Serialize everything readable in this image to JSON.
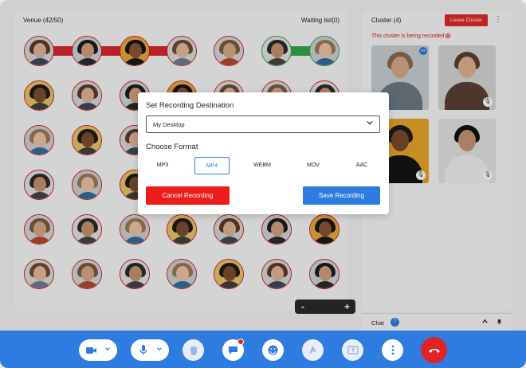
{
  "venue": {
    "title": "Venue (42/50)",
    "waiting": "Waiting list(0)"
  },
  "cluster": {
    "title": "Cluster (4)",
    "leave_label": "Leave Cluster",
    "more_icon": "⋮",
    "recording_note": "This cluster is being recorded"
  },
  "zoom": {
    "minus": "-",
    "plus": "+"
  },
  "chat": {
    "label": "Chat",
    "count": "7"
  },
  "modal": {
    "title": "Set Recording Destination",
    "destination": "My Desktop",
    "format_title": "Choose Format",
    "formats": [
      "MP3",
      "MP4",
      "WEBM",
      "MOV",
      "AAC"
    ],
    "selected_format": "MP4",
    "cancel_label": "Cancel Recording",
    "save_label": "Save Recording"
  },
  "toolbar": {
    "icons": [
      "camera-icon",
      "microphone-icon",
      "raise-hand-icon",
      "chat-icon",
      "emoji-icon",
      "share-screen-icon",
      "present-icon",
      "more-icon",
      "end-call-icon"
    ]
  },
  "colors": {
    "accent": "#2f7ce0",
    "danger": "#e02323",
    "seat_border": "#d31b1b",
    "connected": "#36a64a"
  }
}
